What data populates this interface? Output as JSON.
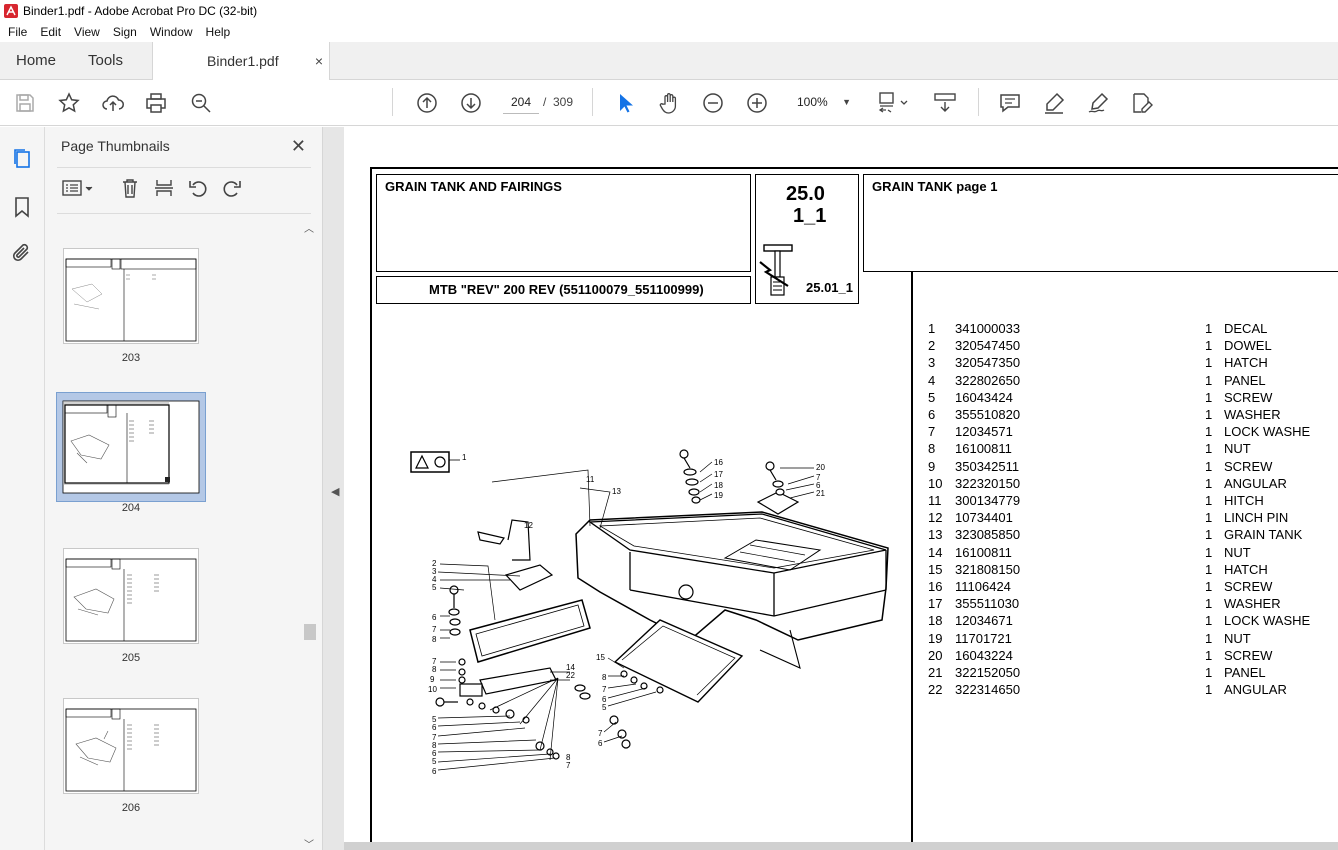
{
  "window": {
    "title": "Binder1.pdf - Adobe Acrobat Pro DC (32-bit)"
  },
  "menu": [
    "File",
    "Edit",
    "View",
    "Sign",
    "Window",
    "Help"
  ],
  "tabs": {
    "home": "Home",
    "tools": "Tools",
    "document": "Binder1.pdf",
    "close": "×"
  },
  "toolbar": {
    "current_page": "204",
    "page_separator": "/",
    "total_pages": "309",
    "zoom": "100%",
    "icons": [
      "save-icon",
      "bookmark-star-icon",
      "upload-icon",
      "print-icon",
      "zoom-search-icon",
      "page-up-icon",
      "page-down-icon",
      "select-arrow-icon",
      "hand-icon",
      "zoom-out-icon",
      "zoom-in-icon",
      "fit-page-icon",
      "scroll-mode-icon",
      "comment-icon",
      "highlight-icon",
      "sign-icon",
      "edit-pdf-icon"
    ]
  },
  "rail": {
    "icons": [
      "page-thumbnails-icon",
      "bookmarks-icon",
      "attachments-icon"
    ]
  },
  "thumbnails": {
    "title": "Page Thumbnails",
    "close": "✕",
    "pages": [
      {
        "label": "203",
        "selected": false
      },
      {
        "label": "204",
        "selected": true
      },
      {
        "label": "205",
        "selected": false
      },
      {
        "label": "206",
        "selected": false
      }
    ]
  },
  "document": {
    "header_left": "GRAIN TANK AND FAIRINGS",
    "header_code_top": "25.0",
    "header_code_bottom": "1_1",
    "header_code_ref": "25.01_1",
    "header_right": "GRAIN TANK  page 1",
    "model_line": "MTB \"REV\" 200 REV (551100079_551100999)",
    "parts": [
      {
        "n": "1",
        "code": "341000033",
        "qty": "1",
        "desc": "DECAL"
      },
      {
        "n": "2",
        "code": "320547450",
        "qty": "1",
        "desc": "DOWEL"
      },
      {
        "n": "3",
        "code": "320547350",
        "qty": "1",
        "desc": "HATCH"
      },
      {
        "n": "4",
        "code": "322802650",
        "qty": "1",
        "desc": "PANEL"
      },
      {
        "n": "5",
        "code": "16043424",
        "qty": "1",
        "desc": "SCREW"
      },
      {
        "n": "6",
        "code": "355510820",
        "qty": "1",
        "desc": "WASHER"
      },
      {
        "n": "7",
        "code": "12034571",
        "qty": "1",
        "desc": "LOCK WASHE"
      },
      {
        "n": "8",
        "code": "16100811",
        "qty": "1",
        "desc": "NUT"
      },
      {
        "n": "9",
        "code": "350342511",
        "qty": "1",
        "desc": "SCREW"
      },
      {
        "n": "10",
        "code": "322320150",
        "qty": "1",
        "desc": "ANGULAR"
      },
      {
        "n": "11",
        "code": "300134779",
        "qty": "1",
        "desc": "HITCH"
      },
      {
        "n": "12",
        "code": "10734401",
        "qty": "1",
        "desc": "LINCH PIN"
      },
      {
        "n": "13",
        "code": "323085850",
        "qty": "1",
        "desc": "GRAIN TANK"
      },
      {
        "n": "14",
        "code": "16100811",
        "qty": "1",
        "desc": "NUT"
      },
      {
        "n": "15",
        "code": "321808150",
        "qty": "1",
        "desc": "HATCH"
      },
      {
        "n": "16",
        "code": "11106424",
        "qty": "1",
        "desc": "SCREW"
      },
      {
        "n": "17",
        "code": "355511030",
        "qty": "1",
        "desc": "WASHER"
      },
      {
        "n": "18",
        "code": "12034671",
        "qty": "1",
        "desc": "LOCK WASHE"
      },
      {
        "n": "19",
        "code": "11701721",
        "qty": "1",
        "desc": "NUT"
      },
      {
        "n": "20",
        "code": "16043224",
        "qty": "1",
        "desc": "SCREW"
      },
      {
        "n": "21",
        "code": "322152050",
        "qty": "1",
        "desc": "PANEL"
      },
      {
        "n": "22",
        "code": "322314650",
        "qty": "1",
        "desc": "ANGULAR"
      }
    ],
    "callouts": [
      "1",
      "2",
      "3",
      "4",
      "5",
      "6",
      "7",
      "8",
      "9",
      "10",
      "11",
      "12",
      "13",
      "14",
      "15",
      "16",
      "17",
      "18",
      "19",
      "20",
      "21",
      "22"
    ]
  }
}
